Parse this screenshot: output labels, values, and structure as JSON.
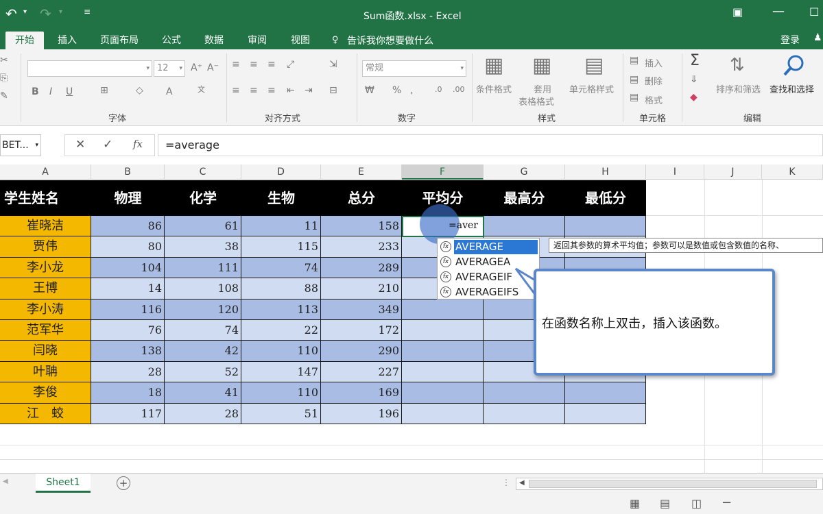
{
  "titlebar": {
    "undo_icon": "undo-icon",
    "title": "Sum函数.xlsx - Excel"
  },
  "tabs": [
    {
      "label": "开始"
    },
    {
      "label": "插入"
    },
    {
      "label": "页面布局"
    },
    {
      "label": "公式"
    },
    {
      "label": "数据"
    },
    {
      "label": "审阅"
    },
    {
      "label": "视图"
    }
  ],
  "tellme": "告诉我你想要做什么",
  "login": "登录",
  "ribbon": {
    "font_size": "12",
    "number_format": "常规",
    "groups": {
      "font": "字体",
      "alignment": "对齐方式",
      "number": "数字",
      "styles": "样式",
      "cells": "单元格",
      "editing": "编辑"
    },
    "styles_buttons": {
      "conditional": "条件格式",
      "table1": "套用",
      "table2": "表格格式",
      "cell_styles": "单元格样式"
    },
    "cells_buttons": {
      "insert": "插入",
      "delete": "删除",
      "format": "格式"
    },
    "editing_buttons": {
      "sort": "排序和筛选",
      "find": "查找和选择"
    }
  },
  "formula_bar": {
    "name_box": "BET...",
    "formula": "=average"
  },
  "columns": [
    "A",
    "B",
    "C",
    "D",
    "E",
    "F",
    "G",
    "H",
    "I",
    "J",
    "K"
  ],
  "table": {
    "headers": [
      "学生姓名",
      "物理",
      "化学",
      "生物",
      "总分",
      "平均分",
      "最高分",
      "最低分"
    ],
    "rows": [
      {
        "name": "崔晓洁",
        "phys": "86",
        "chem": "61",
        "bio": "11",
        "total": "158"
      },
      {
        "name": "贾伟",
        "phys": "80",
        "chem": "38",
        "bio": "115",
        "total": "233"
      },
      {
        "name": "李小龙",
        "phys": "104",
        "chem": "111",
        "bio": "74",
        "total": "289"
      },
      {
        "name": "王博",
        "phys": "14",
        "chem": "108",
        "bio": "88",
        "total": "210"
      },
      {
        "name": "李小涛",
        "phys": "116",
        "chem": "120",
        "bio": "113",
        "total": "349"
      },
      {
        "name": "范军华",
        "phys": "76",
        "chem": "74",
        "bio": "22",
        "total": "172"
      },
      {
        "name": "闫晓",
        "phys": "138",
        "chem": "42",
        "bio": "110",
        "total": "290"
      },
      {
        "name": "叶聃",
        "phys": "28",
        "chem": "52",
        "bio": "147",
        "total": "227"
      },
      {
        "name": "李俊",
        "phys": "18",
        "chem": "41",
        "bio": "110",
        "total": "169"
      },
      {
        "name": "江　蛟",
        "phys": "117",
        "chem": "28",
        "bio": "51",
        "total": "196"
      }
    ]
  },
  "editing_cell": "=aver",
  "autocomplete": [
    "AVERAGE",
    "AVERAGEA",
    "AVERAGEIF",
    "AVERAGEIFS"
  ],
  "tooltip": "返回其参数的算术平均值；参数可以是数值或包含数值的名称、",
  "callout": "在函数名称上双击，插入该函数。",
  "sheet_tab": "Sheet1",
  "colors": {
    "excel_green": "#217346",
    "name_col": "#f5b800",
    "blue_dark": "#a9bde4",
    "blue_light": "#d0dcf2"
  }
}
